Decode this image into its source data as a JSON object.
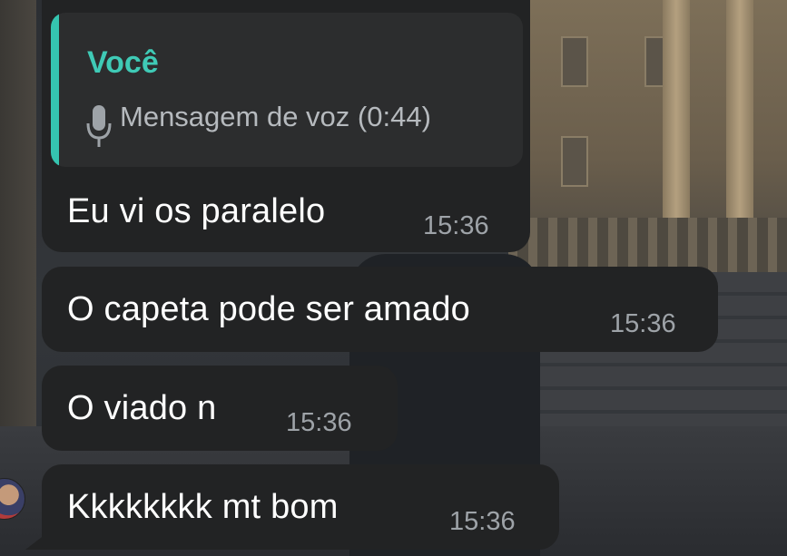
{
  "colors": {
    "bubble_bg": "#222324",
    "reply_bg": "#2c2d2e",
    "reply_accent": "#35c4b0",
    "author_name": "#3fcab6",
    "message_text": "#ffffff",
    "timestamp": "#9ea3a8"
  },
  "chat": {
    "messages": [
      {
        "reply": {
          "author": "Você",
          "icon": "microphone-icon",
          "text": "Mensagem de voz (0:44)"
        },
        "text": "Eu vi os paralelo",
        "time": "15:36"
      },
      {
        "text": "O capeta pode ser amado",
        "time": "15:36"
      },
      {
        "text": "O viado n",
        "time": "15:36"
      },
      {
        "text": "Kkkkkkkk mt bom",
        "time": "15:36"
      }
    ]
  }
}
